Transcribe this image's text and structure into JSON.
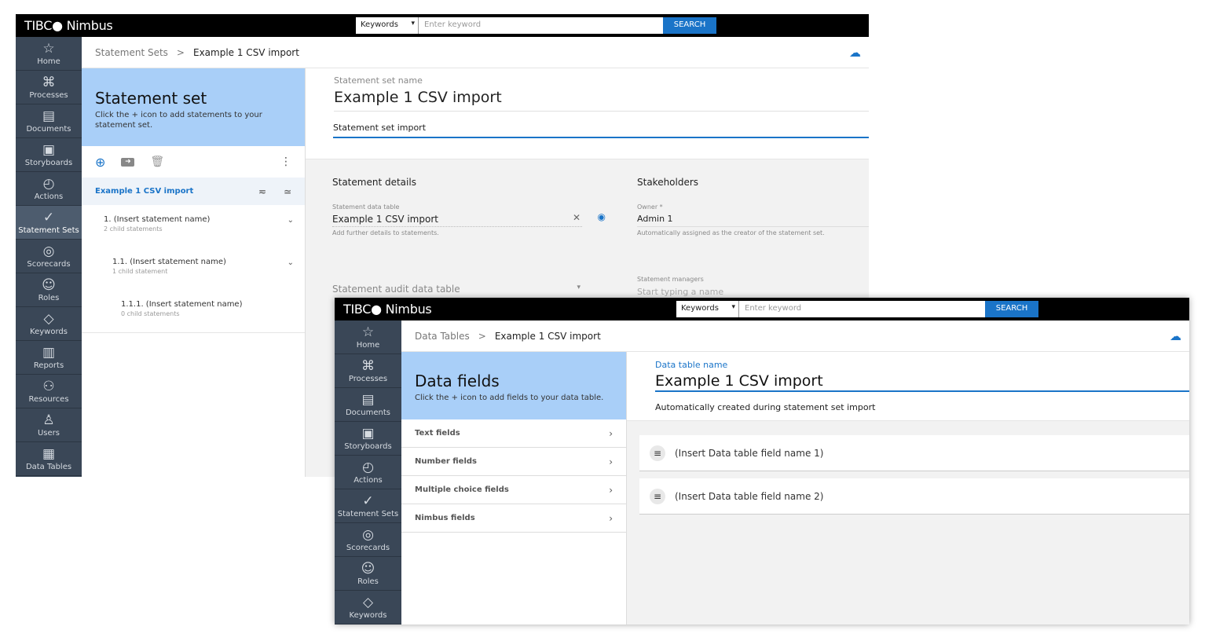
{
  "brand": "TIBC● Nimbus",
  "search": {
    "scope": "Keywords",
    "placeholder": "Enter keyword",
    "button": "SEARCH"
  },
  "nav1": [
    "Home",
    "Processes",
    "Documents",
    "Storyboards",
    "Actions",
    "Statement Sets",
    "Scorecards",
    "Roles",
    "Keywords",
    "Reports",
    "Resources",
    "Users",
    "Data Tables"
  ],
  "nav2": [
    "Home",
    "Processes",
    "Documents",
    "Storyboards",
    "Actions",
    "Statement Sets",
    "Scorecards",
    "Roles",
    "Keywords"
  ],
  "w1": {
    "breadcrumb": [
      "Statement Sets",
      "Example 1 CSV import"
    ],
    "panel_title": "Statement set",
    "panel_hint": "Click the + icon to add statements to your statement set.",
    "tree_root": "Example 1 CSV import",
    "tree": [
      {
        "name": "1. (Insert statement name)",
        "sub": "2 child statements"
      },
      {
        "name": "1.1. (Insert statement name)",
        "sub": "1 child statement"
      },
      {
        "name": "1.1.1. (Insert statement name)",
        "sub": "0 child statements"
      }
    ],
    "name_label": "Statement set name",
    "name_value": "Example 1 CSV import",
    "description": "Statement set import",
    "details_title": "Statement details",
    "data_table_label": "Statement data table",
    "data_table_value": "Example 1 CSV import",
    "data_table_hint": "Add further details to statements.",
    "audit_label": "Statement audit data table",
    "stakeholders_title": "Stakeholders",
    "owner_label": "Owner *",
    "owner_value": "Admin 1",
    "owner_hint": "Automatically assigned as the creator of the statement set.",
    "managers_label": "Statement managers",
    "managers_placeholder": "Start typing a name"
  },
  "w2": {
    "breadcrumb": [
      "Data Tables",
      "Example 1 CSV import"
    ],
    "panel_title": "Data fields",
    "panel_hint": "Click the + icon to add fields to your data table.",
    "categories": [
      "Text fields",
      "Number fields",
      "Multiple choice fields",
      "Nimbus fields"
    ],
    "name_label": "Data table name",
    "name_value": "Example 1 CSV import",
    "description": "Automatically created during statement set import",
    "fields": [
      "(Insert Data table field name 1)",
      "(Insert Data table field name 2)"
    ]
  }
}
